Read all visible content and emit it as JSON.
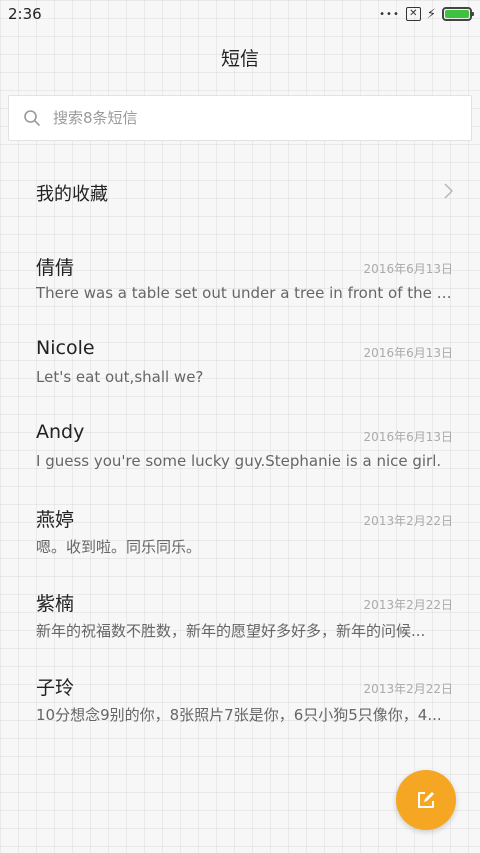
{
  "status_bar": {
    "time": "2:36",
    "signal_dots": "•••",
    "sim_icon": "sim-error-icon",
    "charging_icon": "charging-bolt-icon",
    "battery_level": 1.0,
    "battery_color": "#3cc23c"
  },
  "header": {
    "title": "短信"
  },
  "search": {
    "placeholder": "搜索8条短信",
    "value": ""
  },
  "favorites": {
    "label": "我的收藏"
  },
  "conversations": [
    {
      "name": "倩倩",
      "date": "2016年6月13日",
      "preview": "There was a table set out under a tree in front of the ho..."
    },
    {
      "name": "Nicole",
      "date": "2016年6月13日",
      "preview": "Let's eat out,shall we?"
    },
    {
      "name": "Andy",
      "date": "2016年6月13日",
      "preview": "I guess you're some lucky guy.Stephanie is a nice girl."
    },
    {
      "name": "燕婷",
      "date": "2013年2月22日",
      "preview": "嗯。收到啦。同乐同乐。"
    },
    {
      "name": "紫楠",
      "date": "2013年2月22日",
      "preview": "新年的祝福数不胜数，新年的愿望好多好多，新年的问候..."
    },
    {
      "name": "子玲",
      "date": "2013年2月22日",
      "preview": "10分想念9别的你，8张照片7张是你，6只小狗5只像你，4..."
    }
  ],
  "fab": {
    "icon": "compose-icon",
    "color": "#f5a623"
  }
}
